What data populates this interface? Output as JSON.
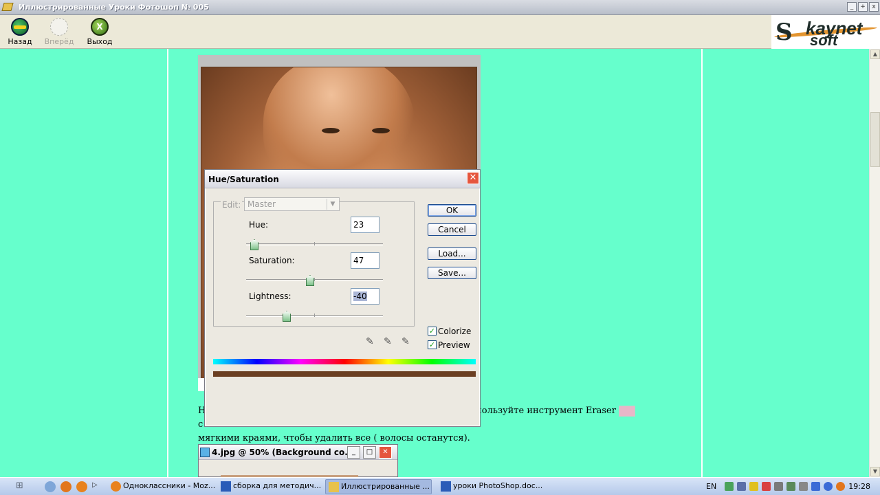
{
  "window": {
    "title": "Иллюстрированные Уроки Фотошоп № 005",
    "buttons": [
      "_",
      "+",
      "x"
    ]
  },
  "toolbar": {
    "back_label": "Назад",
    "forward_label": "Вперёд",
    "exit_label": "Выход"
  },
  "logo": {
    "brand_s": "S",
    "brand_top": "kaynet",
    "brand_bottom": "soft"
  },
  "dialog": {
    "title": "Hue/Saturation",
    "edit_label": "Edit:",
    "edit_value": "Master",
    "hue_label": "Hue:",
    "hue_value": "23",
    "saturation_label": "Saturation:",
    "saturation_value": "47",
    "lightness_label": "Lightness:",
    "lightness_value": "-40",
    "ok_label": "OK",
    "cancel_label": "Cancel",
    "load_label": "Load...",
    "save_label": "Save...",
    "colorize_label": "Colorize",
    "colorize_checked": true,
    "preview_label": "Preview",
    "preview_checked": true
  },
  "paragraph": {
    "before": "Нажмите Shft + Ctrl + I, чтобы инвертировать выбор, и используйте инструмент Eraser",
    "after_icon": "с",
    "line2": "мягкими краями, чтобы удалить все ( волосы останутся)."
  },
  "window2": {
    "title": "4.jpg @ 50% (Background co..."
  },
  "taskbar": {
    "tasks": [
      "Одноклассники - Moz...",
      "сборка для методич...",
      "Иллюстрированные ...",
      "уроки PhotoShop.doc..."
    ],
    "lang": "EN",
    "clock": "19:28"
  },
  "colors": {
    "content_bg": "#66ffcc",
    "accent": "#e5553d"
  }
}
